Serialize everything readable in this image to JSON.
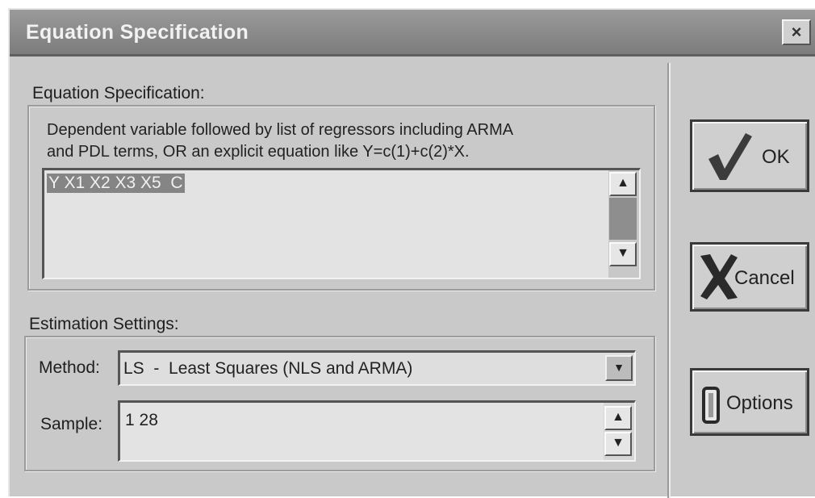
{
  "window": {
    "title": "Equation Specification",
    "close_label": "×"
  },
  "equation": {
    "group_label": "Equation Specification:",
    "hint_line1": "Dependent variable followed by list of regressors including ARMA",
    "hint_line2": "and PDL terms, OR an explicit equation like Y=c(1)+c(2)*X.",
    "value": "Y X1 X2 X3 X5  C"
  },
  "estimation": {
    "group_label": "Estimation Settings:",
    "method_label": "Method:",
    "method_value": "LS  -  Least Squares (NLS and ARMA)",
    "sample_label": "Sample:",
    "sample_value": "1 28"
  },
  "buttons": {
    "ok": "OK",
    "cancel": "Cancel",
    "options": "Options"
  },
  "icons": {
    "scroll_up": "scroll-up-arrow-icon",
    "scroll_down": "scroll-down-arrow-icon",
    "dropdown": "chevron-down-icon",
    "ok": "checkmark-icon",
    "cancel": "x-icon",
    "options": "options-icon"
  }
}
